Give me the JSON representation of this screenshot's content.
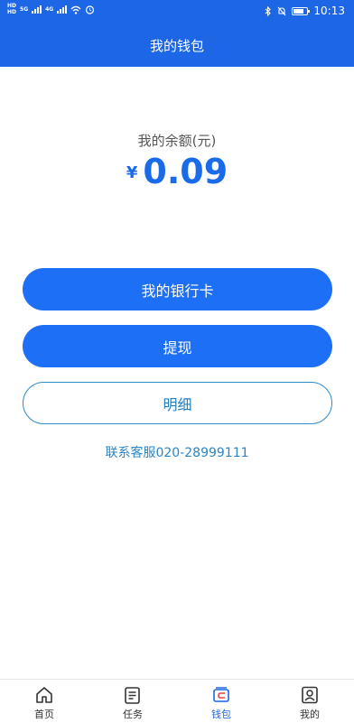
{
  "status_bar": {
    "time": "10:13",
    "network_left": "HD",
    "network_label_1": "5G",
    "network_label_2": "4G"
  },
  "header": {
    "title": "我的钱包"
  },
  "balance": {
    "label": "我的余额(元)",
    "currency_symbol": "¥",
    "amount": "0.09"
  },
  "actions": {
    "bank_card_label": "我的银行卡",
    "withdraw_label": "提现",
    "detail_label": "明细"
  },
  "customer_service": "联系客服020-28999111",
  "colors": {
    "primary": "#1d67e6",
    "button_blue": "#1d6ff5",
    "link_blue": "#2a86c4"
  },
  "tabbar": {
    "items": [
      {
        "label": "首页",
        "icon": "home-icon"
      },
      {
        "label": "任务",
        "icon": "task-icon"
      },
      {
        "label": "钱包",
        "icon": "wallet-icon",
        "active": true
      },
      {
        "label": "我的",
        "icon": "profile-icon"
      }
    ]
  }
}
